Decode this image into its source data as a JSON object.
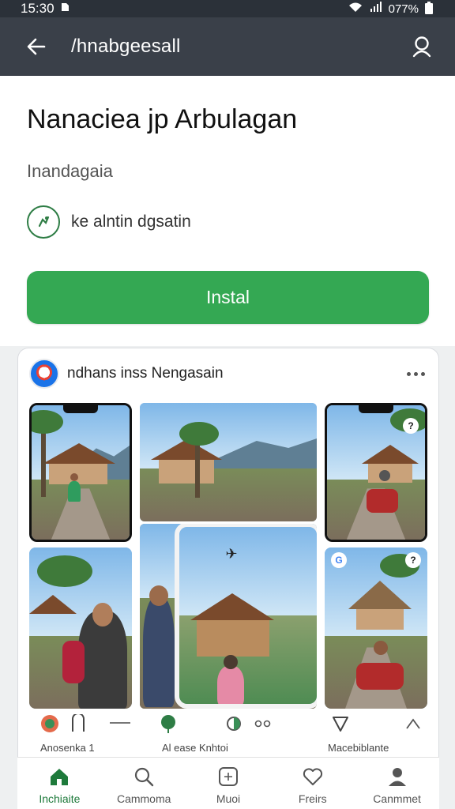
{
  "status": {
    "time": "15:30",
    "battery": "077%"
  },
  "app_bar": {
    "title": "/hnabgeesall",
    "back_icon": "arrow-left-icon",
    "search_icon": "search-icon"
  },
  "app": {
    "name": "Nanaciea jp Arbulagan",
    "developer": "Inandagaia",
    "badge_text": "ke alntin dgsatin",
    "install_label": "Instal",
    "install_color": "#34a853"
  },
  "feed": {
    "title": "ndhans inss Nengasain",
    "actions_left_caption": "Anosenka 1",
    "actions_mid_caption": "Al ease Knhtoi",
    "actions_right_caption": "Macebiblante"
  },
  "nav": {
    "items": [
      {
        "label": "Inchiaite",
        "icon": "home-icon"
      },
      {
        "label": "Cammoma",
        "icon": "search-icon"
      },
      {
        "label": "Muoi",
        "icon": "apps-icon"
      },
      {
        "label": "Freirs",
        "icon": "heart-icon"
      },
      {
        "label": "Canmmet",
        "icon": "person-icon"
      }
    ],
    "active_color": "#1e7a3b"
  }
}
